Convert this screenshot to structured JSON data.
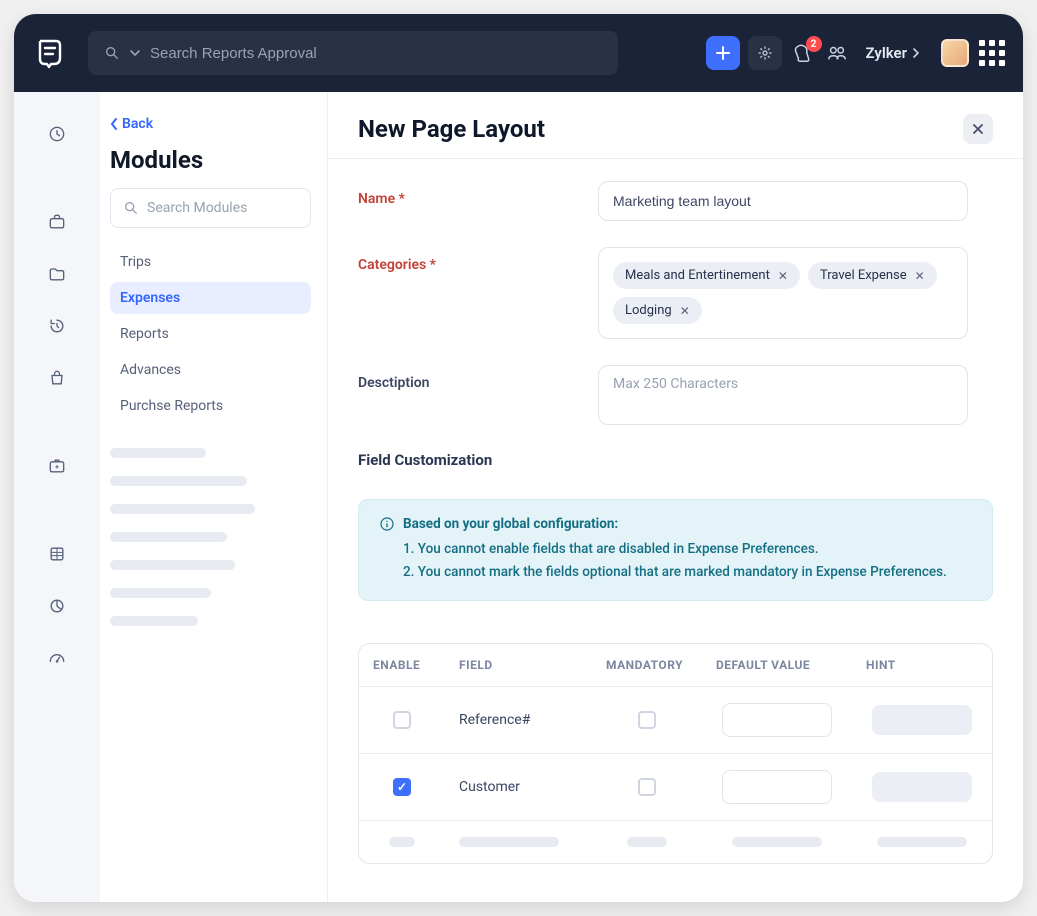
{
  "header": {
    "search_placeholder": "Search Reports Approval",
    "notifications_count": "2",
    "workspace": "Zylker"
  },
  "modules_panel": {
    "back_label": "Back",
    "title": "Modules",
    "search_placeholder": "Search Modules",
    "items": [
      {
        "label": "Trips"
      },
      {
        "label": "Expenses"
      },
      {
        "label": "Reports"
      },
      {
        "label": "Advances"
      },
      {
        "label": "Purchse Reports"
      }
    ],
    "active_index": 1
  },
  "main": {
    "title": "New Page Layout",
    "fields": {
      "name_label": "Name *",
      "name_value": "Marketing team layout",
      "categories_label": "Categories *",
      "categories": [
        "Meals and Entertinement",
        "Travel Expense",
        "Lodging"
      ],
      "description_label": "Desctiption",
      "description_placeholder": "Max 250 Characters"
    },
    "field_customization": {
      "title": "Field Customization",
      "banner": {
        "heading": "Based on your global configuration:",
        "lines": [
          "1. You cannot enable fields that are disabled in Expense Preferences.",
          "2. You cannot mark the fields optional that are marked mandatory in Expense Preferences."
        ]
      },
      "columns": {
        "enable": "ENABLE",
        "field": "FIELD",
        "mandatory": "MANDATORY",
        "default": "DEFAULT VALUE",
        "hint": "HINT"
      },
      "rows": [
        {
          "enabled": false,
          "field": "Reference#",
          "mandatory": false
        },
        {
          "enabled": true,
          "field": "Customer",
          "mandatory": false
        }
      ]
    }
  }
}
